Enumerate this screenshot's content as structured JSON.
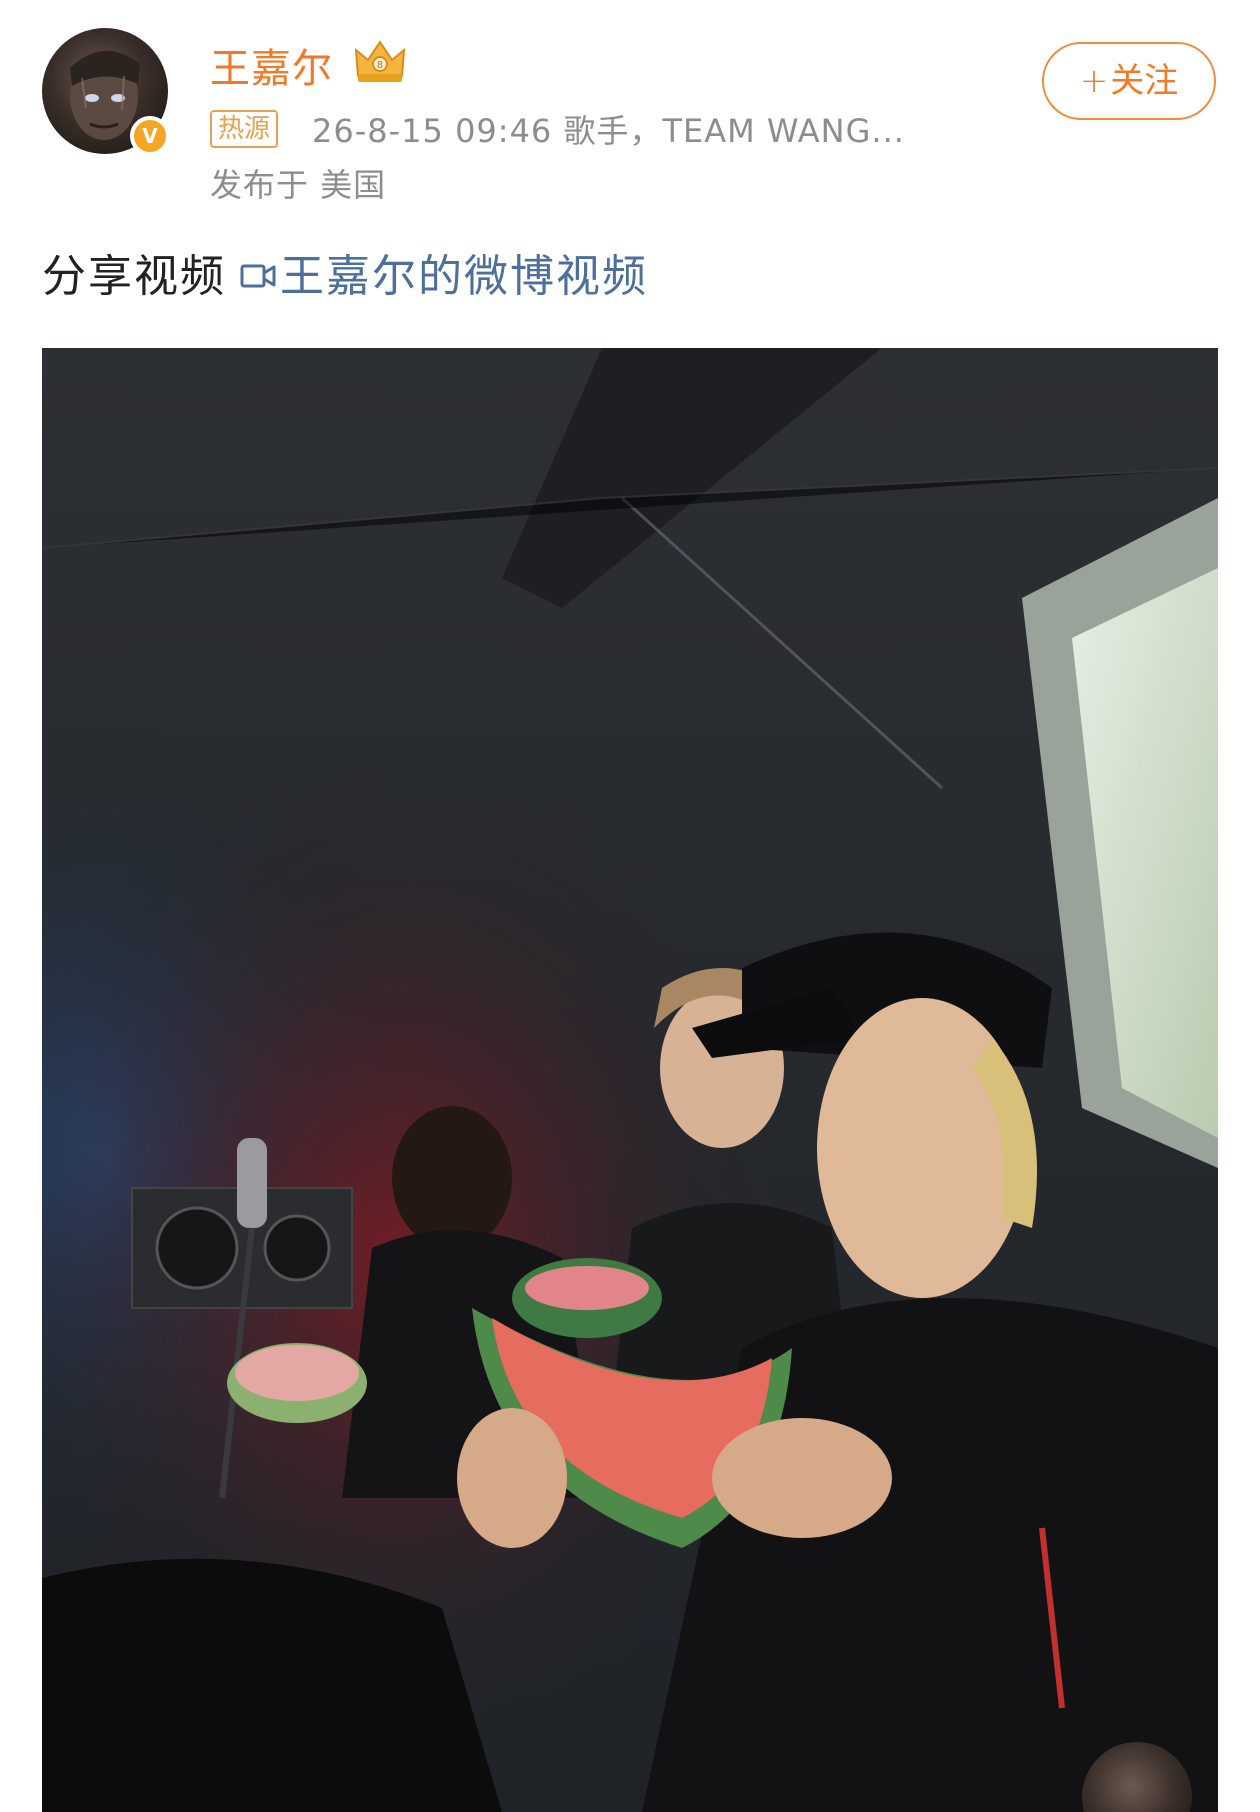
{
  "post": {
    "username": "王嘉尔",
    "hot_badge": "热源",
    "meta": "26-8-15 09:46  歌手，TEAM WANG...",
    "location": "发布于 美国",
    "follow_button": {
      "plus": "+",
      "label": "关注"
    },
    "text": "分享视频",
    "video_link_label": "王嘉尔的微博视频"
  },
  "icons": {
    "avatar": "user-avatar",
    "verified": "verified-v-icon",
    "crown": "crown-icon",
    "video": "video-camera-icon"
  },
  "colors": {
    "username": "#f07a28",
    "follow_border": "#f08c3a",
    "hot_badge": "#e8a14e",
    "meta": "#8d8d8d",
    "link": "#4d6f9c",
    "verified": "#f5a623"
  },
  "verified_badge_text": "V"
}
